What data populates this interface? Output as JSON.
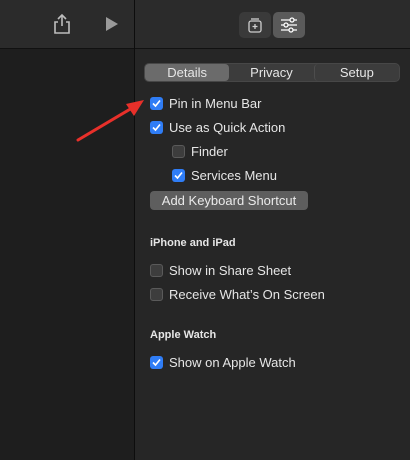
{
  "toolbar": {
    "icons": [
      "share-icon",
      "play-icon",
      "add-to-library-icon",
      "settings-sliders-icon"
    ]
  },
  "tabs": [
    {
      "label": "Details",
      "active": true
    },
    {
      "label": "Privacy",
      "active": false
    },
    {
      "label": "Setup",
      "active": false
    }
  ],
  "options": {
    "pin_menu_bar": {
      "label": "Pin in Menu Bar",
      "checked": true
    },
    "quick_action": {
      "label": "Use as Quick Action",
      "checked": true
    },
    "finder": {
      "label": "Finder",
      "checked": false
    },
    "services_menu": {
      "label": "Services Menu",
      "checked": true
    }
  },
  "add_shortcut_label": "Add Keyboard Shortcut",
  "iphone_section": {
    "title": "iPhone and iPad",
    "share_sheet": {
      "label": "Show in Share Sheet",
      "checked": false
    },
    "whats_on_screen": {
      "label": "Receive What’s On Screen",
      "checked": false
    }
  },
  "watch_section": {
    "title": "Apple Watch",
    "show_on_watch": {
      "label": "Show on Apple Watch",
      "checked": true
    }
  },
  "colors": {
    "accent": "#2f7df6",
    "annotation_arrow": "#e8302a"
  }
}
